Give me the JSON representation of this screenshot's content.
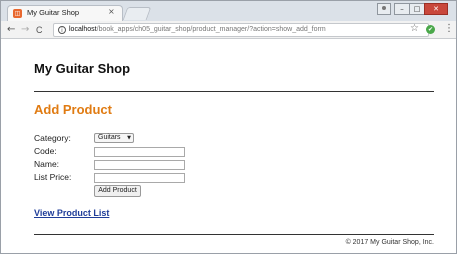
{
  "browser": {
    "tab_title": "My Guitar Shop",
    "tab_close": "×",
    "favicon_glyph": "◫",
    "nav": {
      "back": "←",
      "forward": "→",
      "reload": "C"
    },
    "url_host": "localhost",
    "url_path": "/book_apps/ch05_guitar_shop/product_manager/?action=show_add_form",
    "info_glyph": "i",
    "star_glyph": "☆",
    "ext_glyph": "✔",
    "menu_glyph": "⋮",
    "window_controls": {
      "minimize": "–",
      "maximize": "□",
      "close": "✕"
    }
  },
  "page": {
    "site_title": "My Guitar Shop",
    "heading": "Add Product",
    "form": {
      "category_label": "Category:",
      "category_value": "Guitars",
      "select_arrow": "▼",
      "code_label": "Code:",
      "code_value": "",
      "name_label": "Name:",
      "name_value": "",
      "price_label": "List Price:",
      "price_value": "",
      "submit_label": "Add Product"
    },
    "view_link": "View Product List",
    "footer": "© 2017 My Guitar Shop, Inc."
  },
  "colors": {
    "heading": "#e07b12",
    "link": "#1f3d99",
    "close_button": "#c9483c"
  }
}
